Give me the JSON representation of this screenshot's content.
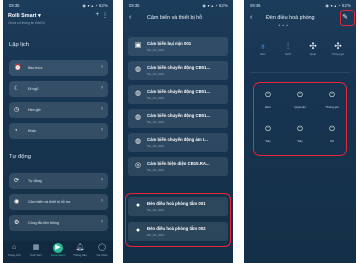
{
  "screen1": {
    "status": {
      "time": "09:35",
      "icons": "◉ ▾ ▴ ◔ 62%"
    },
    "app_name": "Rolli Smart ▾",
    "subtitle": "Chưa có thông tin thiết bị",
    "header_icons": [
      "plus-icon",
      "menu-icon"
    ],
    "section_schedule": "Lập lịch",
    "schedule_items": [
      {
        "icon": "alarm-icon",
        "label": "Báo thức"
      },
      {
        "icon": "moon-icon",
        "label": "Đi ngủ"
      },
      {
        "icon": "timer-icon",
        "label": "Hẹn giờ"
      },
      {
        "icon": "clock-icon",
        "label": "Khác"
      }
    ],
    "section_auto": "Tự động",
    "auto_items": [
      {
        "icon": "refresh-icon",
        "label": "Tự động"
      },
      {
        "icon": "sensor-icon",
        "label": "Cảm biến và thiết bị hỗ trợ"
      },
      {
        "icon": "gear-icon",
        "label": "Công tắc liên thông"
      }
    ],
    "tabs": [
      {
        "label": "Trang chủ",
        "icon": "home-icon"
      },
      {
        "label": "Kịch bản",
        "icon": "scene-icon"
      },
      {
        "label": "Automation",
        "icon": "automation-icon"
      },
      {
        "label": "Thông báo",
        "icon": "bell-icon"
      },
      {
        "label": "Cá nhân",
        "icon": "user-icon"
      }
    ]
  },
  "screen2": {
    "status": {
      "time": "09:35",
      "icons": "◉ ▾ ▴ ◔ 62%"
    },
    "title": "Cảm biến và thiết bị hỗ",
    "devices": [
      {
        "name": "Cảm biến bụi mịn 001",
        "code": "RD_HC_8261"
      },
      {
        "name": "Cảm biến chuyển động CB01...",
        "code": "RD_HC_8261"
      },
      {
        "name": "Cảm biến chuyển động CB01...",
        "code": "RD_HC_8261"
      },
      {
        "name": "Cảm biến chuyển động CB01...",
        "code": "RD_HC_8261"
      },
      {
        "name": "Cảm biến chuyển động ám t...",
        "code": "RD_HC_8261"
      },
      {
        "name": "Cảm biến hiện diện CB15.RA...",
        "code": "RD_HC_8261"
      },
      {
        "name": "Đèn điều hoà phòng tắm 001",
        "code": "RD_HC_8261"
      },
      {
        "name": "Đèn điều hoà phòng tắm 002",
        "code": "RD_HC_8261"
      }
    ]
  },
  "screen3": {
    "status": {
      "time": "09:36",
      "icons": "◉ ▾ ▴ ◔ 62%"
    },
    "title": "Đèn điều hoà phòng",
    "subtitle": "▲ ▲ ▲",
    "modes": [
      {
        "label": "Đèn",
        "icon": "bulb-icon"
      },
      {
        "label": "Sưởi",
        "icon": "heater-icon"
      },
      {
        "label": "Quạt",
        "icon": "fan-icon"
      },
      {
        "label": "Thông gió",
        "icon": "vent-icon"
      }
    ],
    "buttons": [
      {
        "label": "Đèn"
      },
      {
        "label": "Quạt tản"
      },
      {
        "label": "Thông gió"
      },
      {
        "label": "Sấy"
      },
      {
        "label": "Sấy"
      },
      {
        "label": "Off"
      }
    ]
  },
  "colors": {
    "bg_top": "#1b3c5a",
    "bg_bottom": "#143047",
    "accent": "#2bb79b",
    "highlight": "#e8243a",
    "selected_mode": "#5fb0ff"
  }
}
